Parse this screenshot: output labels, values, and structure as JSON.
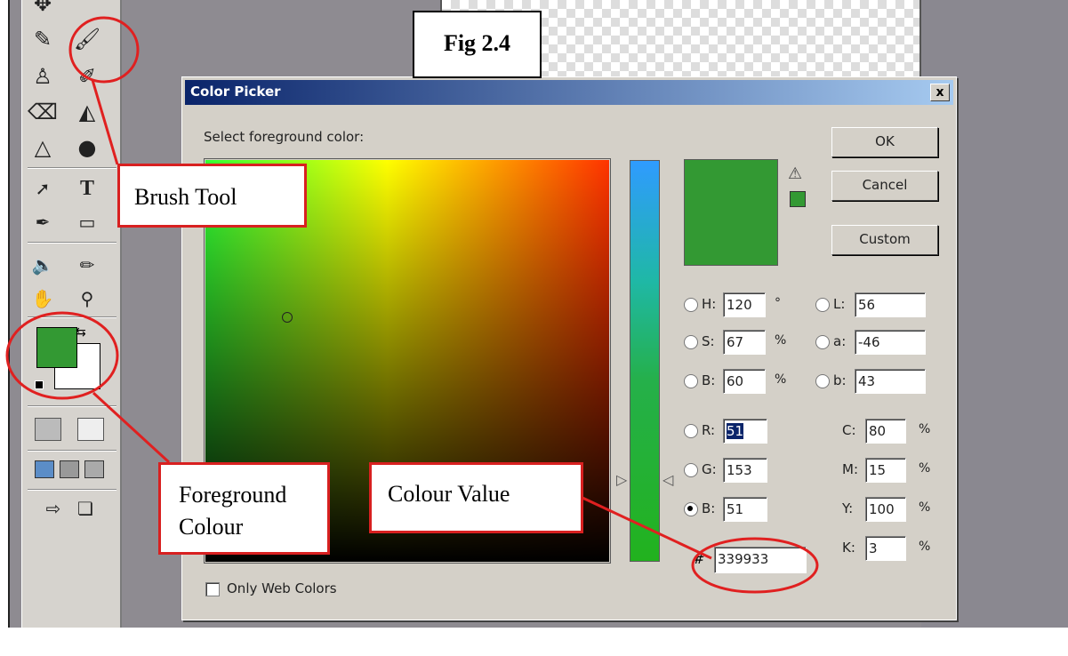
{
  "figure_label": "Fig 2.4",
  "dialog": {
    "title": "Color Picker",
    "close_label": "x",
    "prompt": "Select foreground color:",
    "buttons": {
      "ok": "OK",
      "cancel": "Cancel",
      "custom": "Custom"
    },
    "selected_color_hex": "#339933",
    "hsb": [
      {
        "label": "H:",
        "value": "120",
        "unit": "°",
        "selected": false
      },
      {
        "label": "S:",
        "value": "67",
        "unit": "%",
        "selected": false
      },
      {
        "label": "B:",
        "value": "60",
        "unit": "%",
        "selected": false
      }
    ],
    "lab": [
      {
        "label": "L:",
        "value": "56",
        "selected": false
      },
      {
        "label": "a:",
        "value": "-46",
        "selected": false
      },
      {
        "label": "b:",
        "value": "43",
        "selected": false
      }
    ],
    "rgb": [
      {
        "label": "R:",
        "value": "51",
        "selected": false
      },
      {
        "label": "G:",
        "value": "153",
        "selected": false
      },
      {
        "label": "B:",
        "value": "51",
        "selected": true
      }
    ],
    "cmyk": [
      {
        "label": "C:",
        "value": "80",
        "unit": "%"
      },
      {
        "label": "M:",
        "value": "15",
        "unit": "%"
      },
      {
        "label": "Y:",
        "value": "100",
        "unit": "%"
      },
      {
        "label": "K:",
        "value": "3",
        "unit": "%"
      }
    ],
    "hex_symbol": "#",
    "hex_value": "339933",
    "only_web_colors": {
      "label": "Only Web Colors",
      "checked": false
    }
  },
  "toolbox": {
    "foreground_color": "#339933",
    "background_color": "#ffffff",
    "type_tool_glyph": "T"
  },
  "annotations": {
    "brush_tool": "Brush Tool",
    "foreground_colour_line1": "Foreground",
    "foreground_colour_line2": "Colour",
    "colour_value": "Colour Value"
  }
}
